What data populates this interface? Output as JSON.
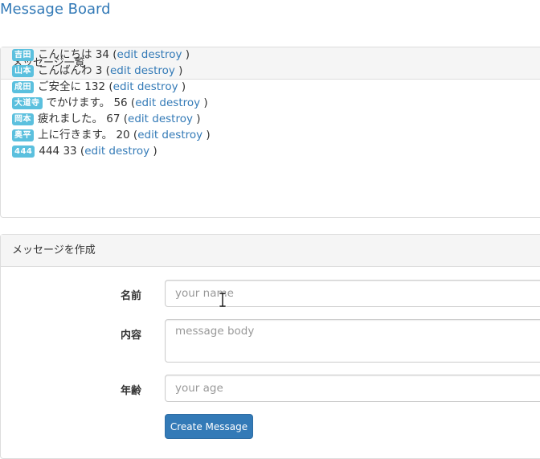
{
  "header": {
    "brand": "Message Board"
  },
  "list_panel": {
    "title": "メッセージ一覧",
    "messages": [
      {
        "name": "吉田",
        "body": "こんにちは",
        "age": "34",
        "edit": "edit",
        "destroy": "destroy"
      },
      {
        "name": "山本",
        "body": "こんばんわ",
        "age": "3",
        "edit": "edit",
        "destroy": "destroy"
      },
      {
        "name": "成田",
        "body": "ご安全に",
        "age": "132",
        "edit": "edit",
        "destroy": "destroy"
      },
      {
        "name": "大道寺",
        "body": "でかけます。",
        "age": "56",
        "edit": "edit",
        "destroy": "destroy"
      },
      {
        "name": "岡本",
        "body": "疲れました。",
        "age": "67",
        "edit": "edit",
        "destroy": "destroy"
      },
      {
        "name": "奥平",
        "body": "上に行きます。",
        "age": "20",
        "edit": "edit",
        "destroy": "destroy"
      },
      {
        "name": "444",
        "body": "444",
        "age": "33",
        "edit": "edit",
        "destroy": "destroy"
      }
    ]
  },
  "form_panel": {
    "title": "メッセージを作成",
    "name_label": "名前",
    "name_placeholder": "your name",
    "body_label": "内容",
    "body_placeholder": "message body",
    "age_label": "年齢",
    "age_placeholder": "your age",
    "submit_label": "Create Message"
  },
  "colors": {
    "link": "#337ab7",
    "label_bg": "#5bc0de",
    "button_bg": "#337ab7",
    "panel_heading_bg": "#f5f5f5"
  },
  "icons": {
    "cursor": "text-cursor-icon"
  }
}
